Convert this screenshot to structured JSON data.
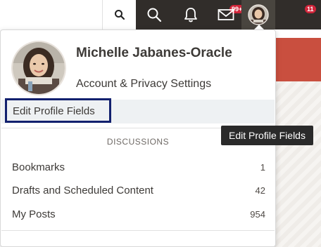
{
  "topbar": {
    "notifications_badge": "99+",
    "messages_badge": "11",
    "icons": [
      "search-icon",
      "search-icon",
      "bell-icon",
      "envelope-icon",
      "avatar"
    ]
  },
  "menu": {
    "profile_name": "Michelle Jabanes-Oracle",
    "account_link": "Account & Privacy Settings",
    "edit_profile": "Edit Profile Fields",
    "section_heading": "DISCUSSIONS",
    "items": [
      {
        "label": "Bookmarks",
        "count": "1"
      },
      {
        "label": "Drafts and Scheduled Content",
        "count": "42"
      },
      {
        "label": "My Posts",
        "count": "954"
      }
    ]
  },
  "tooltip": {
    "text": "Edit Profile Fields"
  },
  "colors": {
    "topbar": "#312d2a",
    "badge": "#d1253a",
    "highlight_border": "#12206e",
    "tooltip_bg": "#2a2a2a",
    "banner": "#c94f3f"
  }
}
